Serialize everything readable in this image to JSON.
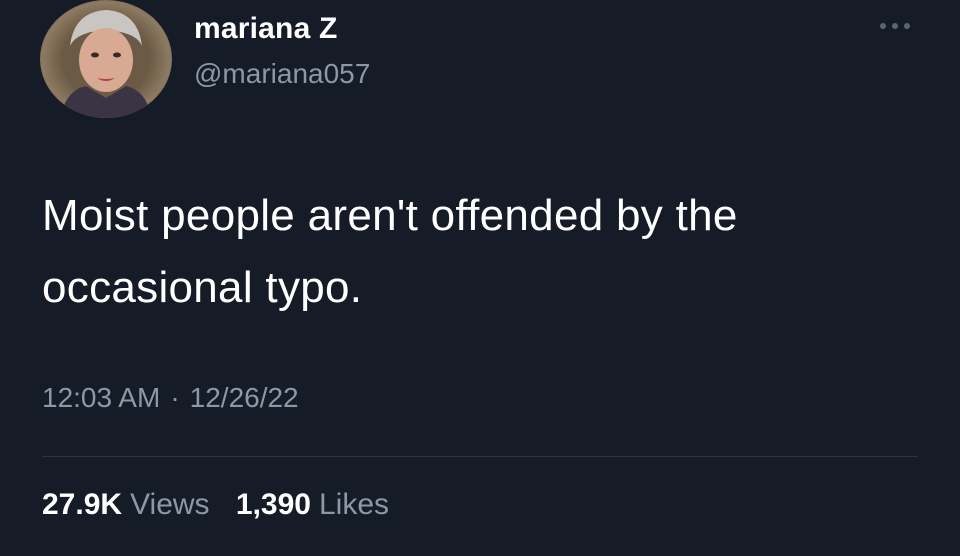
{
  "tweet": {
    "author": {
      "display_name": "mariana Z",
      "handle": "@mariana057"
    },
    "text_lines": [
      "Moist people aren't offended by the",
      "occasional typo."
    ],
    "time": "12:03 AM",
    "separator": "·",
    "date": "12/26/22",
    "stats": {
      "views_count": "27.9K",
      "views_label": "Views",
      "likes_count": "1,390",
      "likes_label": "Likes"
    }
  },
  "icons": {
    "more": "more-horizontal-icon",
    "avatar": "profile-photo"
  },
  "colors": {
    "background": "#161b28",
    "primary_text": "#ffffff",
    "secondary_text": "#8b98a5",
    "divider": "#2f3540"
  }
}
